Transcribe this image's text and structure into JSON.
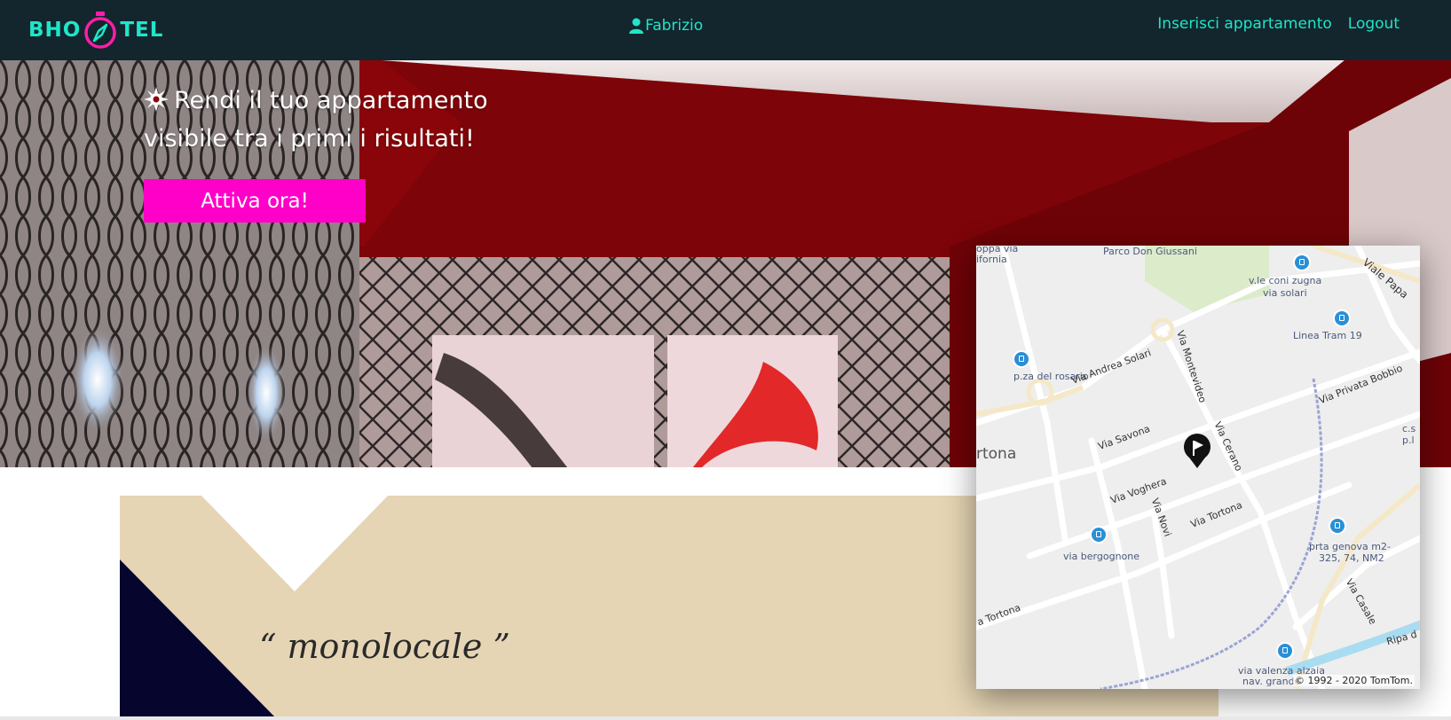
{
  "nav": {
    "logo_left": "BHO",
    "logo_right": "TEL",
    "username": "Fabrizio",
    "insert_link": "Inserisci appartamento",
    "logout_link": "Logout"
  },
  "hero": {
    "headline_line1": "Rendi il tuo appartamento",
    "headline_line2": "visibile tra i primi i risultati!",
    "cta_label": "Attiva ora!"
  },
  "card": {
    "quote": "“ monolocale ”"
  },
  "map": {
    "labels": {
      "parco": "Parco Don Giussani",
      "coppa": "oppa via",
      "fornia": "ifornia",
      "viale_papa": "Viale Papa",
      "coni_zugna": "v.le coni zugna",
      "via_solari_stop": "via solari",
      "linea_tram": "Linea Tram 19",
      "pza_rosario": "p.za del rosario",
      "andrea_solari": "Via Andrea Solari",
      "montevideo": "Via Montevideo",
      "privata_bobbio": "Via Privata Bobbio",
      "tortona_area": "rtona",
      "savona": "Via Savona",
      "cerano": "Via Cerano",
      "cs": "c.s",
      "pl": "p.l",
      "voghera": "Via Voghera",
      "novi": "Via Novi",
      "tortona_street": "Via Tortona",
      "bergognone": "via bergognone",
      "porta_genova_1": "prta genova m2-",
      "porta_genova_2": "325, 74, NM2",
      "casale": "Via Casale",
      "tortona_left": "a Tortona",
      "ripa": "Ripa d",
      "valenza_1": "via valenza alzaia",
      "valenza_2": "nav. grande"
    },
    "copyright": "© 1992 - 2020 TomTom."
  },
  "colors": {
    "navbar_bg": "#13252d",
    "accent_teal": "#1ee6c8",
    "cta_pink": "#ff00c8",
    "hero_red": "#8a0509",
    "card_beige": "#e6d5b4",
    "card_navy": "#05052e"
  },
  "icons": {
    "logo": "compass-icon",
    "user": "user-icon",
    "headline": "sun-icon",
    "map_marker": "flag-marker-icon",
    "bus_stop": "bus-stop-icon"
  }
}
